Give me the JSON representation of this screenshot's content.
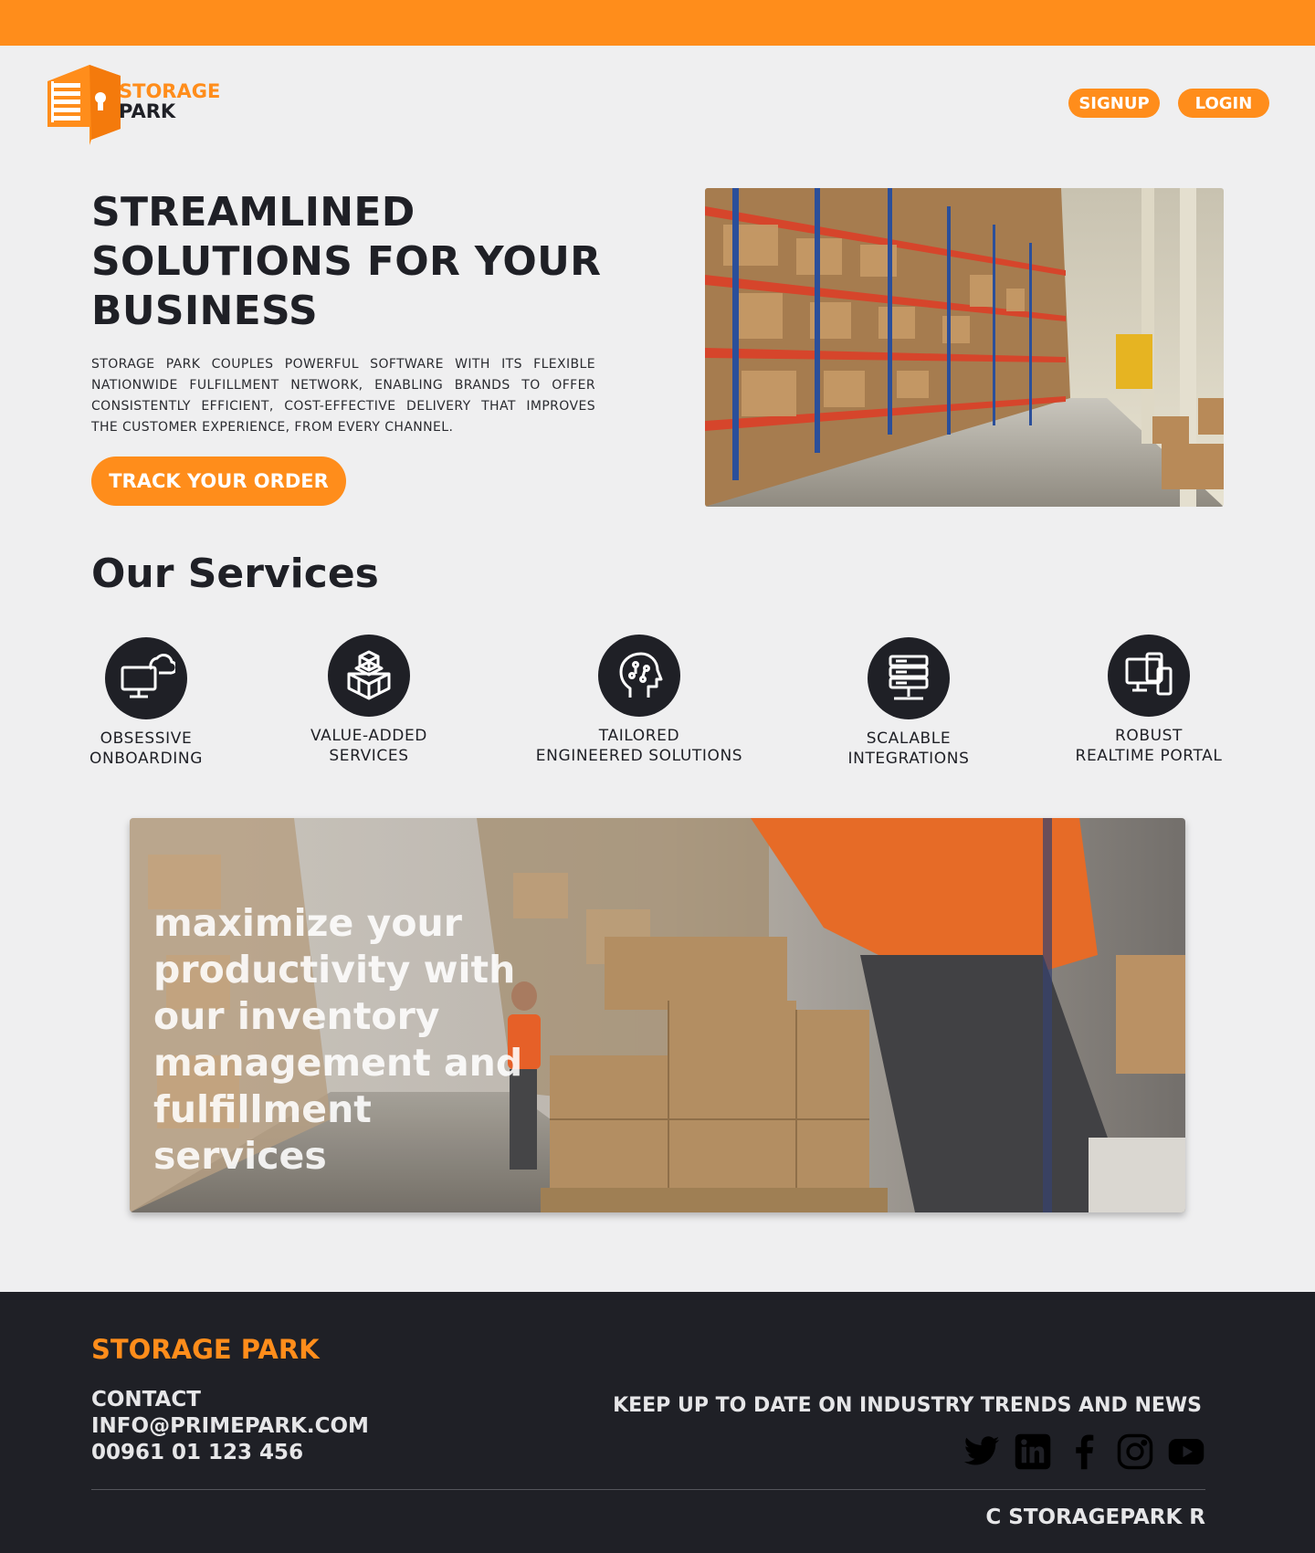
{
  "brand": {
    "logo_line1": "STORAGE",
    "logo_line2": "PARK",
    "accent_color": "#ff8d1b",
    "dark_color": "#1f2026"
  },
  "header": {
    "signup_label": "SIGNUP",
    "login_label": "LOGIN"
  },
  "hero": {
    "title": "STREAMLINED SOLUTIONS FOR YOUR BUSINESS",
    "description": "STORAGE PARK COUPLES POWERFUL SOFTWARE WITH ITS FLEXIBLE NATIONWIDE FULFILLMENT NETWORK, ENABLING BRANDS TO OFFER CONSISTENTLY EFFICIENT, COST-EFFECTIVE DELIVERY THAT IMPROVES THE CUSTOMER EXPERIENCE, FROM EVERY CHANNEL.",
    "cta_label": "TRACK YOUR ORDER"
  },
  "services": {
    "title": "Our Services",
    "items": [
      {
        "line1": "OBSESSIVE",
        "line2": "ONBOARDING",
        "icon": "cloud-monitor-icon"
      },
      {
        "line1": "VALUE-ADDED",
        "line2": "SERVICES",
        "icon": "boxes-icon"
      },
      {
        "line1": "TAILORED",
        "line2": "ENGINEERED SOLUTIONS",
        "icon": "ai-head-icon"
      },
      {
        "line1": "SCALABLE",
        "line2": "INTEGRATIONS",
        "icon": "server-icon"
      },
      {
        "line1": "ROBUST",
        "line2": "REALTIME PORTAL",
        "icon": "devices-icon"
      }
    ]
  },
  "banner": {
    "text": "maximize your productivity with our inventory management and fulfillment services"
  },
  "footer": {
    "brand": "STORAGE PARK",
    "contact_label": "CONTACT",
    "email": "INFO@PRIMEPARK.COM",
    "phone": "00961 01 123 456",
    "newsletter": "KEEP UP TO DATE ON INDUSTRY TRENDS AND NEWS",
    "socials": [
      "twitter-icon",
      "linkedin-icon",
      "facebook-icon",
      "instagram-icon",
      "youtube-icon"
    ],
    "copyright": "C STORAGEPARK R"
  }
}
